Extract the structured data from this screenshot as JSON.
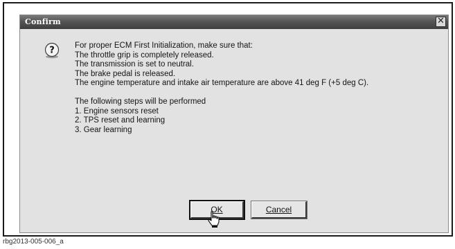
{
  "dialog": {
    "title": "Confirm",
    "close_glyph": "✕",
    "icon": "question-icon",
    "message_lines": [
      "For proper ECM First Initialization, make sure that:",
      "The throttle grip is completely released.",
      "The transmission is set to neutral.",
      "The brake pedal is released.",
      "The engine temperature and intake air temperature are above 41 deg F (+5 deg C)."
    ],
    "steps_lines": [
      "The following steps will be performed",
      "1. Engine sensors reset",
      "2. TPS reset and learning",
      "3. Gear learning"
    ],
    "buttons": {
      "ok": "OK",
      "cancel": "Cancel"
    }
  },
  "caption": "rbg2013-005-006_a",
  "colors": {
    "titlebar": "#555555",
    "dialog_bg": "#e2e2e2",
    "frame_border": "#1a1a1a"
  }
}
